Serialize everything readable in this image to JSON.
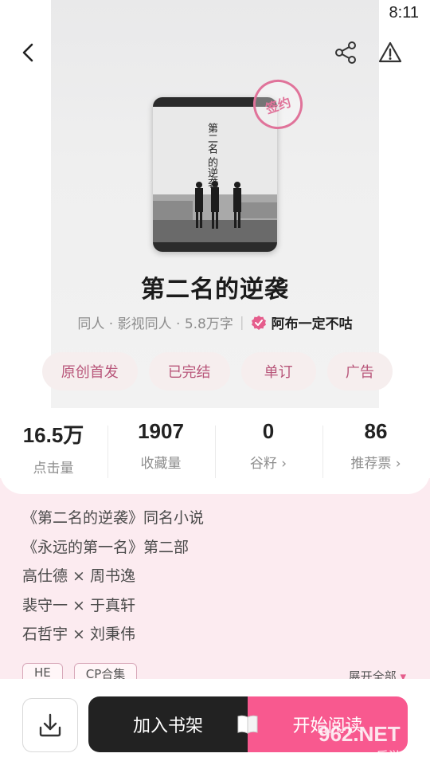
{
  "status_bar": {
    "time": "8:11",
    "icons": [
      "wifi-icon",
      "no-sim-icon",
      "battery-charging-icon"
    ]
  },
  "nav": {
    "icons": [
      "back-arrow-icon",
      "share-icon",
      "report-warning-icon"
    ]
  },
  "book": {
    "cover_title_lines": [
      "第二名",
      "的逆袭"
    ],
    "stamp": "签约",
    "title": "第二名的逆袭",
    "category": "同人 · 影视同人 · 5.8万字",
    "author": "阿布一定不咕",
    "tags": [
      "原创首发",
      "已完结",
      "单订",
      "广告"
    ]
  },
  "stats": [
    {
      "value": "16.5万",
      "label": "点击量"
    },
    {
      "value": "1907",
      "label": "收藏量"
    },
    {
      "value": "0",
      "label": "谷籽 ›"
    },
    {
      "value": "86",
      "label": "推荐票 ›"
    }
  ],
  "description": [
    "《第二名的逆袭》同名小说",
    "《永远的第一名》第二部",
    "高仕德 × 周书逸",
    "裴守一 × 于真轩",
    "石哲宇 × 刘秉伟"
  ],
  "chips": [
    "HE",
    "CP合集"
  ],
  "expand_label": "展开全部",
  "bottom": {
    "add_shelf": "加入书架",
    "start_read": "开始阅读"
  },
  "watermark": {
    "text_top": "962.NET",
    "text_bottom": "乐游网"
  },
  "colors": {
    "accent_pink": "#f8598f",
    "tag_text": "#b8567a",
    "desc_bg": "#fcebf0"
  }
}
